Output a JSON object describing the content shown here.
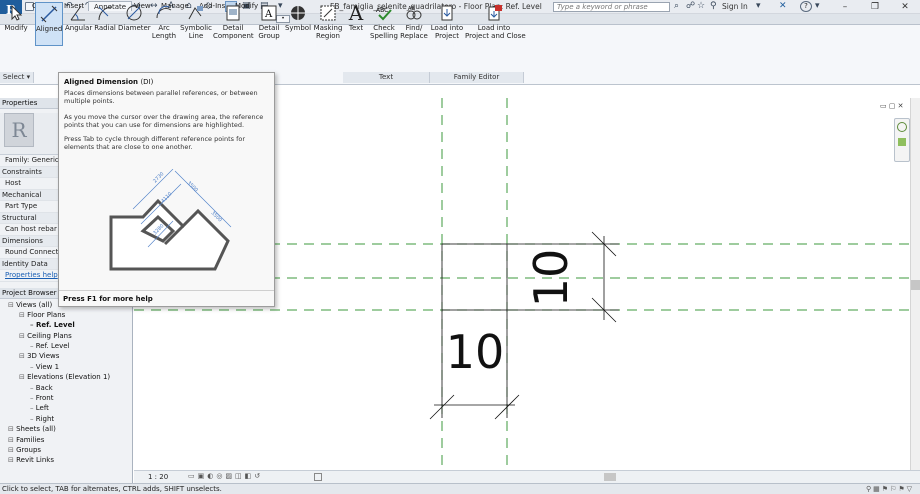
{
  "app": {
    "button_label": "R",
    "doc_title": "FB_famiglia_selenite_quadrilatero - Floor Plan: Ref. Level"
  },
  "search": {
    "placeholder": "Type a keyword or phrase"
  },
  "header": {
    "sign_in": "Sign In",
    "help": "?"
  },
  "tabs": [
    {
      "label": "Create"
    },
    {
      "label": "Insert"
    },
    {
      "label": "Annotate"
    },
    {
      "label": "View"
    },
    {
      "label": "Manage"
    },
    {
      "label": "Add-Ins"
    },
    {
      "label": "Modify"
    }
  ],
  "ribbon": {
    "modify": "Modify",
    "aligned": "Aligned",
    "angular": "Angular",
    "radial": "Radial",
    "diameter": "Diameter",
    "arc_length": "Arc\nLength",
    "symbolic_line": "Symbolic\nLine",
    "detail_component": "Detail\nComponent",
    "detail_group": "Detail\nGroup",
    "symbol": "Symbol",
    "masking_region": "Masking\nRegion",
    "text": "Text",
    "check_spelling": "Check\nSpelling",
    "find_replace": "Find/\nReplace",
    "load_into_project": "Load into\nProject",
    "load_into_project_close": "Load into\nProject and Close",
    "panel_select": "Select ▾",
    "panel_text": "Text",
    "panel_family_editor": "Family Editor"
  },
  "tooltip": {
    "title": "Aligned Dimension",
    "shortcut": "(DI)",
    "desc1": "Places dimensions between parallel references, or between multiple points.",
    "desc2": "As you move the cursor over the drawing area, the reference points that you can use for dimensions are highlighted.",
    "desc3": "Press Tab to cycle through different reference points for elements that are close to one another.",
    "dims": [
      "2730",
      "3500",
      "4110",
      "3280",
      "3500"
    ],
    "footer": "Press F1 for more help"
  },
  "properties": {
    "header": "Properties",
    "family": "Family: Generic M",
    "rows": [
      {
        "text": "Constraints",
        "cat": true
      },
      {
        "text": "Host",
        "cat": false
      },
      {
        "text": "Mechanical",
        "cat": true
      },
      {
        "text": "Part Type",
        "cat": false
      },
      {
        "text": "Structural",
        "cat": true
      },
      {
        "text": "Can host rebar",
        "cat": false
      },
      {
        "text": "Dimensions",
        "cat": true
      },
      {
        "text": "Round Connect...",
        "cat": false
      },
      {
        "text": "Identity Data",
        "cat": true
      }
    ],
    "help_link": "Properties help"
  },
  "browser": {
    "header": "Project Browser - F",
    "items": [
      {
        "text": "Views (all)",
        "indent": 0
      },
      {
        "text": "Floor Plans",
        "indent": 1
      },
      {
        "text": "Ref. Level",
        "indent": 2,
        "bold": true
      },
      {
        "text": "Ceiling Plans",
        "indent": 1
      },
      {
        "text": "Ref. Level",
        "indent": 2
      },
      {
        "text": "3D Views",
        "indent": 1
      },
      {
        "text": "View 1",
        "indent": 2
      },
      {
        "text": "Elevations (Elevation 1)",
        "indent": 1
      },
      {
        "text": "Back",
        "indent": 2
      },
      {
        "text": "Front",
        "indent": 2
      },
      {
        "text": "Left",
        "indent": 2
      },
      {
        "text": "Right",
        "indent": 2
      },
      {
        "text": "Sheets (all)",
        "indent": 0
      },
      {
        "text": "Families",
        "indent": 0
      },
      {
        "text": "Groups",
        "indent": 0
      },
      {
        "text": "Revit Links",
        "indent": 0
      }
    ]
  },
  "canvas": {
    "dim_horizontal": "10",
    "dim_vertical": "10"
  },
  "viewbar": {
    "scale": "1 : 20"
  },
  "status": {
    "text": "Click to select, TAB for alternates, CTRL adds, SHIFT unselects."
  },
  "colors": {
    "ref_plane": "#3d9a3d",
    "ribbon_bg": "#f5f7fa",
    "selection": "#cfe2f6"
  }
}
